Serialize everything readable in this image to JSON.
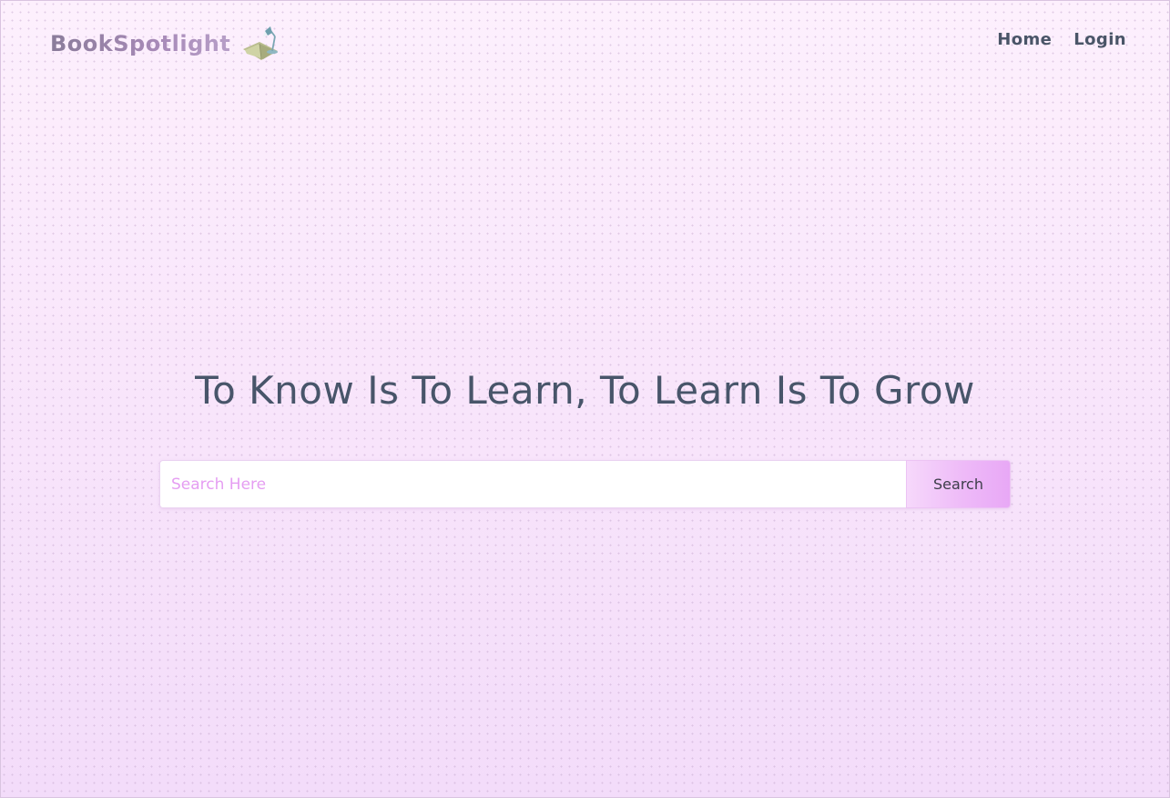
{
  "navbar": {
    "brand": "BookSpotlight",
    "brand_icon": "desk-lamp-book-icon",
    "links": [
      {
        "label": "Home"
      },
      {
        "label": "Login"
      }
    ]
  },
  "hero": {
    "title": "To Know Is To Learn, To Learn Is To Grow"
  },
  "search": {
    "placeholder": "Search Here",
    "value": "",
    "button_label": "Search"
  },
  "colors": {
    "background_top": "#fdf0fd",
    "background_bottom": "#f3dcfa",
    "title_text": "#48556a",
    "placeholder": "#e59ef2",
    "button_accent": "#e8a8f6"
  }
}
